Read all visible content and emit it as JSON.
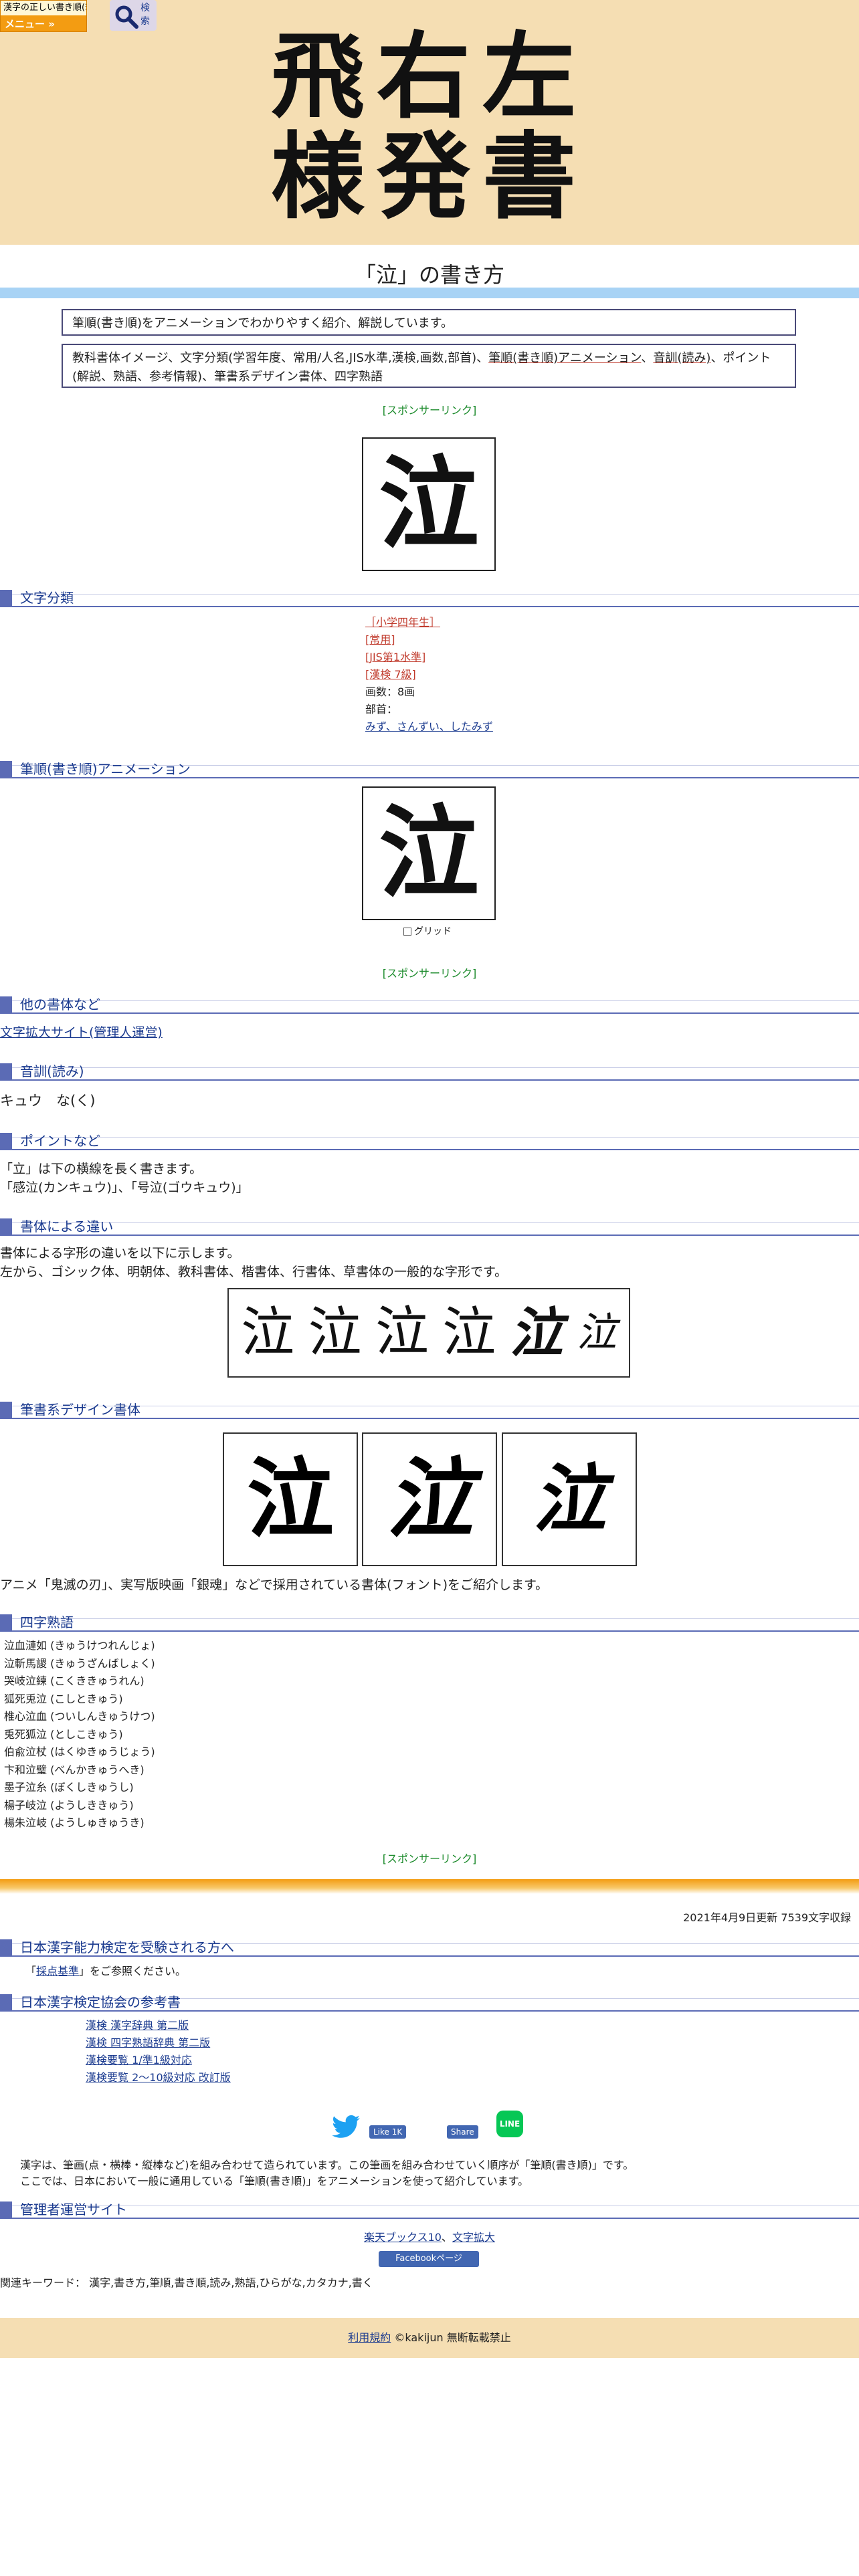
{
  "header": {
    "brand": "漢字の正しい書き順(筆順)",
    "menu_label": "メニュー »",
    "search_label": "検索",
    "hero_title": "飛右左 様発書",
    "hero_line1": "飛右左",
    "hero_line2": "様発書"
  },
  "page": {
    "title": "「泣」の書き方",
    "intro": "筆順(書き順)をアニメーションでわかりやすく紹介、解説しています。",
    "contents_a": "教科書体イメージ、文字分類(学習年度、常用/人名,JIS水準,漢検,画数,部首)、",
    "contents_u1": "筆順(書き順)アニメーション",
    "contents_b": "、",
    "contents_u2": "音訓(読み)",
    "contents_c": "、ポイント(解説、熟語、参考情報)、筆書系デザイン書体、四字熟語",
    "sponsor": "[スポンサーリンク]",
    "kanji": "泣"
  },
  "classification": {
    "section_title": "文字分類",
    "grade": "［小学四年生］",
    "joyo": "[常用]",
    "jis": "[JIS第1水準]",
    "kanken": "[漢検 7級]",
    "strokes": "画数：8画",
    "radical_label": "部首：",
    "radical": "みず、さんずい、したみず"
  },
  "animation": {
    "section_title": "筆順(書き順)アニメーション",
    "grid_label": "グリッド"
  },
  "other_fonts": {
    "section_title": "他の書体など",
    "link": "文字拡大サイト(管理人運営)"
  },
  "readings": {
    "section_title": "音訓(読み)",
    "text": "キュウ　な(く)"
  },
  "points": {
    "section_title": "ポイントなど",
    "line1": "「立」は下の横線を長く書きます。",
    "line2": "「感泣(カンキュウ)」、「号泣(ゴウキュウ)」"
  },
  "styles": {
    "section_title": "書体による違い",
    "line1": "書体による字形の違いを以下に示します。",
    "line2": "左から、ゴシック体、明朝体、教科書体、楷書体、行書体、草書体の一般的な字形です。",
    "glyphs": [
      "泣",
      "泣",
      "泣",
      "泣",
      "泣",
      "泣"
    ]
  },
  "design": {
    "section_title": "筆書系デザイン書体",
    "caption": "アニメ「鬼滅の刃」、実写版映画「銀魂」などで採用されている書体(フォント)をご紹介します。"
  },
  "yoji": {
    "section_title": "四字熟語",
    "items": [
      "泣血漣如 (きゅうけつれんじょ)",
      "泣斬馬謖 (きゅうざんばしょく)",
      "哭岐泣練 (こくききゅうれん)",
      "狐死兎泣 (こしときゅう)",
      "椎心泣血 (ついしんきゅうけつ)",
      "兎死狐泣 (としこきゅう)",
      "伯兪泣杖 (はくゆきゅうじょう)",
      "卞和泣璧 (べんかきゅうへき)",
      "墨子泣糸 (ぼくしきゅうし)",
      "楊子岐泣 (ようしききゅう)",
      "楊朱泣岐 (ようしゅきゅうき)"
    ]
  },
  "updated": "2021年4月9日更新 7539文字収録",
  "kentei": {
    "section_title": "日本漢字能力検定を受験される方へ",
    "text_pre": "「",
    "link": "採点基準",
    "text_post": "」をご参照ください。"
  },
  "references": {
    "section_title": "日本漢字検定協会の参考書",
    "items": [
      "漢検 漢字辞典 第二版",
      "漢検 四字熟語辞典 第二版",
      "漢検要覧 1/準1級対応",
      "漢検要覧 2～10級対応 改訂版"
    ]
  },
  "social": {
    "like": "Like 1K",
    "share": "Share",
    "line": "LINE"
  },
  "explain": {
    "line1": "漢字は、筆画(点・横棒・縦棒など)を組み合わせて造られています。この筆画を組み合わせていく順序が「筆順(書き順)」です。",
    "line2": "ここでは、日本において一般に通用している「筆順(書き順)」をアニメーションを使って紹介しています。"
  },
  "admin": {
    "section_title": "管理者運営サイト",
    "link1": "楽天ブックス10",
    "sep": "、",
    "link2": "文字拡大",
    "fb_page": "Facebookページ"
  },
  "keywords": "関連キーワード： 漢字,書き方,筆順,書き順,読み,熟語,ひらがな,カタカナ,書く",
  "footer": {
    "terms": "利用規約",
    "copyright": "©kakijun 無断転載禁止"
  },
  "colors": {
    "hero_bg": "#f5deb3",
    "section_accent": "#5b6bb5",
    "title_bar": "#a8d3f5",
    "orange": "#f39c12"
  }
}
